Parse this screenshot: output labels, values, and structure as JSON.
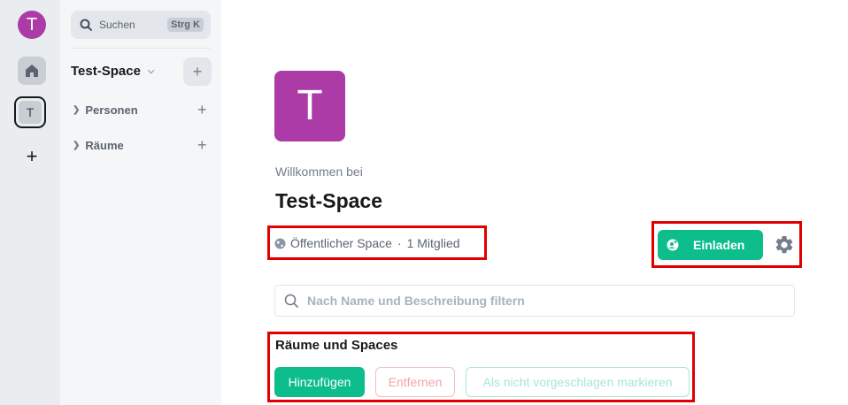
{
  "rail": {
    "avatar_letter": "T",
    "space_letter": "T",
    "home_icon": "home-icon",
    "add_icon": "plus-icon"
  },
  "panel": {
    "search_label": "Suchen",
    "search_shortcut": "Strg K",
    "space_name": "Test-Space",
    "sections": [
      {
        "label": "Personen"
      },
      {
        "label": "Räume"
      }
    ]
  },
  "main": {
    "avatar_letter": "T",
    "welcome": "Willkommen bei",
    "title": "Test-Space",
    "visibility": "Öffentlicher Space",
    "separator": "·",
    "members": "1 Mitglied",
    "invite_label": "Einladen",
    "filter_placeholder": "Nach Name und Beschreibung filtern",
    "rooms_heading": "Räume und Spaces",
    "add_label": "Hinzufügen",
    "remove_label": "Entfernen",
    "unsuggest_label": "Als nicht vorgeschlagen markieren"
  },
  "colors": {
    "accent": "#0dbd8b",
    "avatar": "#ac3ba8",
    "highlight": "#e00000"
  }
}
